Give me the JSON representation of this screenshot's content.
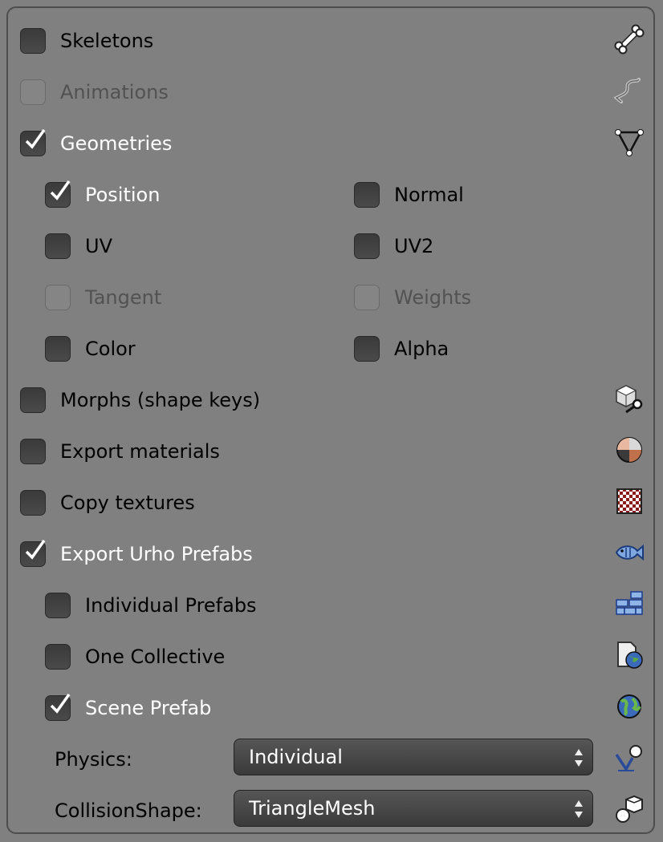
{
  "options": {
    "skeletons": {
      "label": "Skeletons",
      "checked": false,
      "enabled": true,
      "icon": "bone-icon"
    },
    "animations": {
      "label": "Animations",
      "checked": false,
      "enabled": false,
      "icon": "action-curve-icon"
    },
    "geometries": {
      "label": "Geometries",
      "checked": true,
      "enabled": true,
      "icon": "mesh-triangle-icon"
    },
    "position": {
      "label": "Position",
      "checked": true,
      "enabled": true
    },
    "normal": {
      "label": "Normal",
      "checked": false,
      "enabled": true
    },
    "uv": {
      "label": "UV",
      "checked": false,
      "enabled": true
    },
    "uv2": {
      "label": "UV2",
      "checked": false,
      "enabled": true
    },
    "tangent": {
      "label": "Tangent",
      "checked": false,
      "enabled": false
    },
    "weights": {
      "label": "Weights",
      "checked": false,
      "enabled": false
    },
    "color": {
      "label": "Color",
      "checked": false,
      "enabled": true
    },
    "alpha": {
      "label": "Alpha",
      "checked": false,
      "enabled": true
    },
    "morphs": {
      "label": "Morphs (shape keys)",
      "checked": false,
      "enabled": true,
      "icon": "shape-key-icon"
    },
    "export_materials": {
      "label": "Export materials",
      "checked": false,
      "enabled": true,
      "icon": "material-sphere-icon"
    },
    "copy_textures": {
      "label": "Copy textures",
      "checked": false,
      "enabled": true,
      "icon": "texture-checker-icon"
    },
    "export_prefabs": {
      "label": "Export Urho Prefabs",
      "checked": true,
      "enabled": true,
      "icon": "fish-icon"
    },
    "individual_prefabs": {
      "label": "Individual Prefabs",
      "checked": false,
      "enabled": true,
      "icon": "bricks-icon"
    },
    "one_collective": {
      "label": "One Collective",
      "checked": false,
      "enabled": true,
      "icon": "world-document-icon"
    },
    "scene_prefab": {
      "label": "Scene Prefab",
      "checked": true,
      "enabled": true,
      "icon": "globe-icon"
    }
  },
  "physics": {
    "label": "Physics:",
    "value": "Individual",
    "icon": "physics-icon"
  },
  "collision_shape": {
    "label": "CollisionShape:",
    "value": "TriangleMesh",
    "icon": "collision-shapes-icon"
  },
  "colors": {
    "panel_bg": "#808080",
    "checkbox": "#404040",
    "checked_text": "#ffffff",
    "disabled_text": "#525252"
  }
}
